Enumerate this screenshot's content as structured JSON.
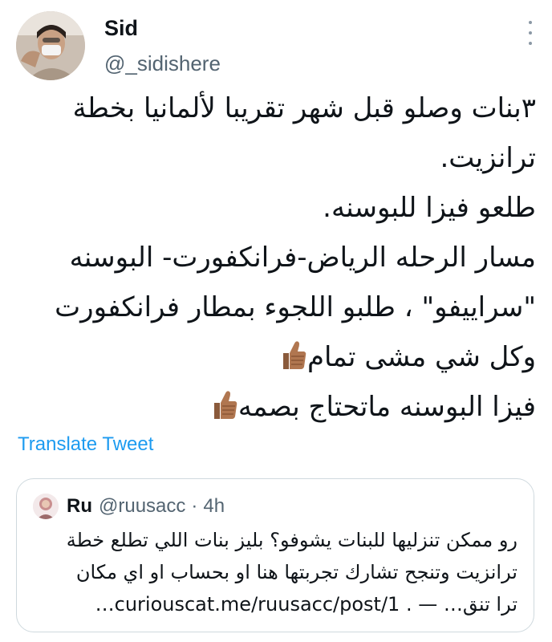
{
  "author": {
    "name": "Sid",
    "handle": "@_sidishere"
  },
  "tweet": {
    "lines": [
      "٣بنات وصلو قبل شهر تقريبا لألمانيا بخطة",
      "ترانزيت.",
      "طلعو فيزا للبوسنه.",
      "مسار الرحله الرياض-فرانكفورت- البوسنه",
      "\"سراييفو\" ، طلبو اللجوء بمطار فرانكفورت",
      "وكل شي مشى تمام",
      "فيزا البوسنه ماتحتاج بصمه"
    ],
    "emoji": [
      "thumbs-up-medium-dark-skin",
      "thumbs-up-medium-dark-skin"
    ]
  },
  "translate_label": "Translate Tweet",
  "quoted": {
    "name": "Ru",
    "handle": "@ruusacc",
    "separator": "·",
    "time": "4h",
    "lines": [
      "رو ممكن تنزليها للبنات يشوفو؟ بليز بنات اللي تطلع خطة",
      "ترانزيت وتنجح تشارك تجربتها هنا او بحساب او اي مكان",
      "ترا تنق… — . curiouscat.me/ruusacc/post/1…"
    ]
  },
  "colors": {
    "text": "#0f1419",
    "secondary": "#536471",
    "link": "#1d9bf0",
    "border": "#cfd9de"
  }
}
